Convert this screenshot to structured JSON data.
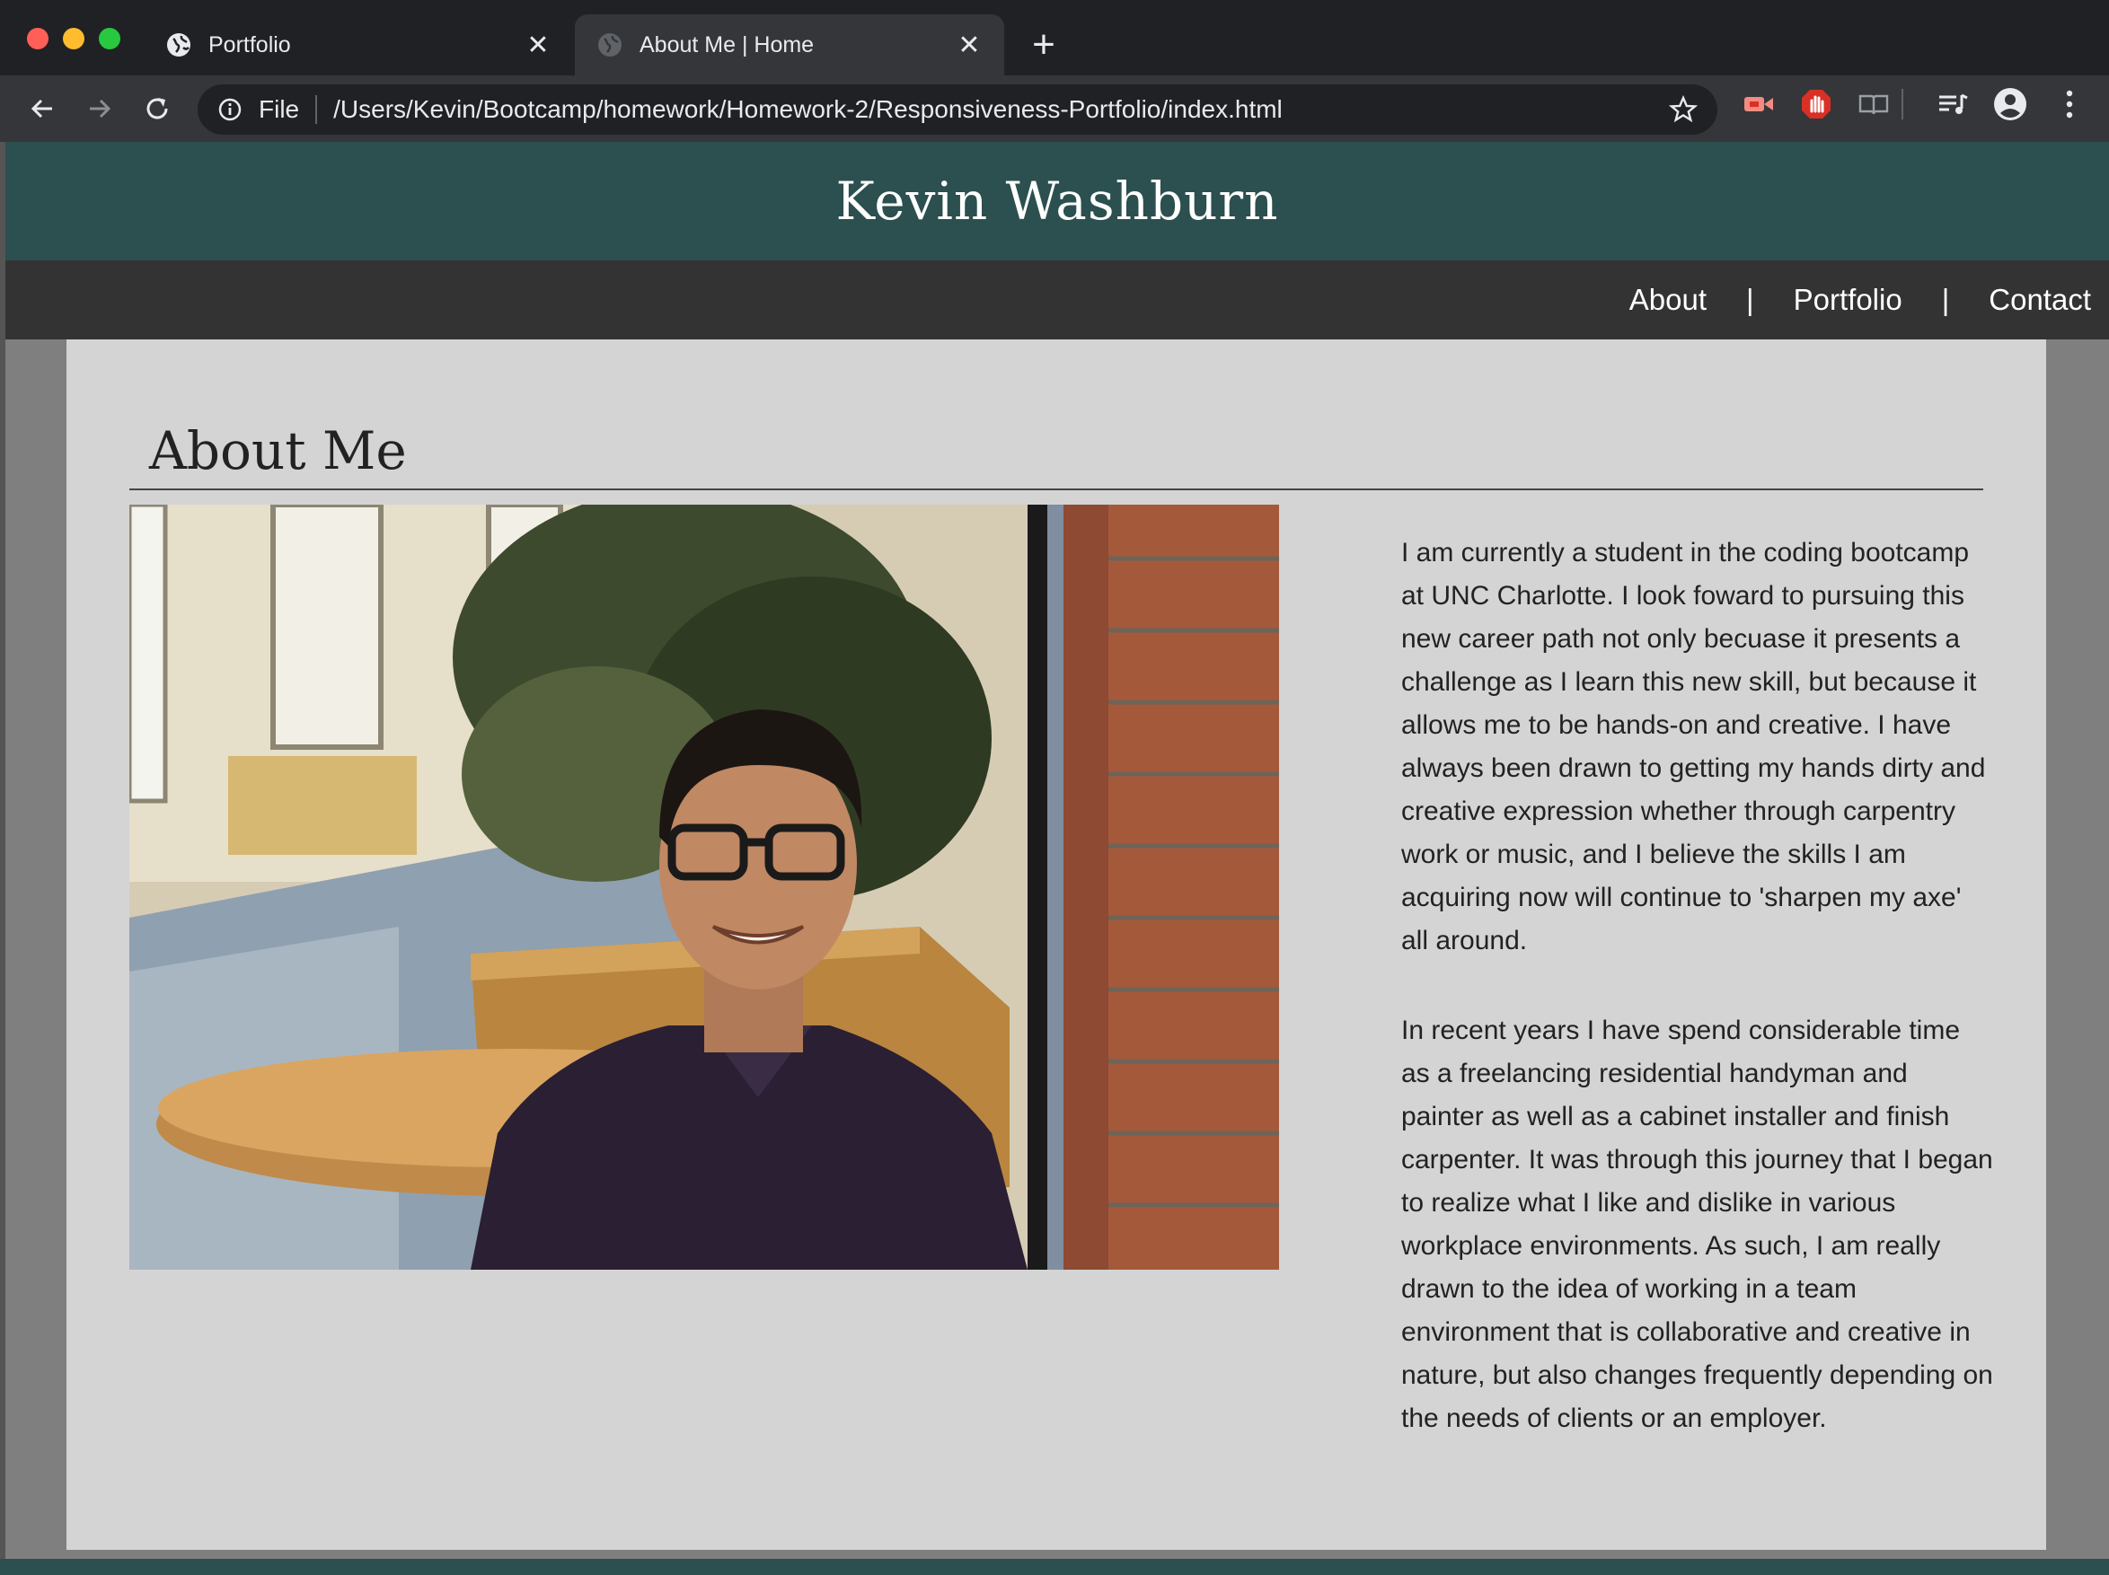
{
  "browser": {
    "tabs": [
      {
        "title": "Portfolio",
        "active": false
      },
      {
        "title": "About Me | Home",
        "active": true
      }
    ],
    "address": {
      "scheme": "File",
      "url": "/Users/Kevin/Bootcamp/homework/Homework-2/Responsiveness-Portfolio/index.html"
    },
    "icons": [
      "back-icon",
      "forward-icon",
      "reload-icon",
      "info-icon",
      "star-icon",
      "extension-icon",
      "adblock-icon",
      "reading-list-icon",
      "media-icon",
      "profile-icon",
      "menu-icon"
    ]
  },
  "site": {
    "title": "Kevin Washburn",
    "nav": {
      "about": "About",
      "portfolio": "Portfolio",
      "contact": "Contact",
      "separator": "|"
    },
    "accent": "#2c4f4f"
  },
  "about": {
    "heading": "About Me",
    "paragraphs": [
      "I am currently a student in the coding bootcamp at UNC Charlotte. I look foward to pursuing this new career path not only becuase it presents a challenge as I learn this new skill, but because it allows me to be hands-on and creative. I have always been drawn to getting my hands dirty and creative expression whether through carpentry work or music, and I believe the skills I am acquiring now will continue to 'sharpen my axe' all around.",
      "In recent years I have spend considerable time as a freelancing residential handyman and painter as well as a cabinet installer and finish carpenter. It was through this journey that I began to realize what I like and dislike in various workplace environments. As such, I am really drawn to the idea of working in a team environment that is collaborative and creative in nature, but also changes frequently depending on the needs of clients or an employer."
    ]
  }
}
